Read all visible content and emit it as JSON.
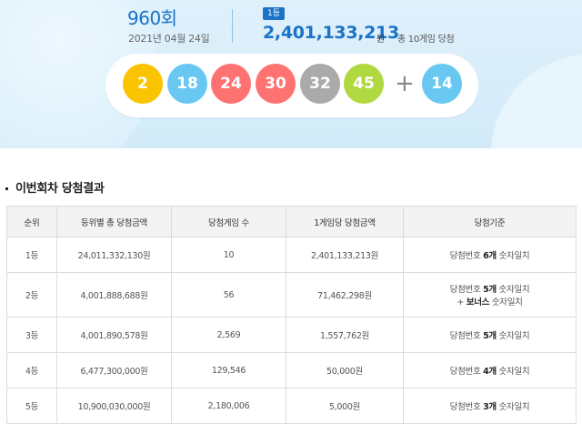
{
  "draw": {
    "round": "960회",
    "date": "2021년 04월 24일",
    "rank_badge": "1등",
    "prize": "2,401,133,213",
    "prize_unit": "원",
    "winners": "총 10게임 당첨",
    "numbers": [
      {
        "value": "2",
        "color": "#fbc400"
      },
      {
        "value": "18",
        "color": "#69c8f2"
      },
      {
        "value": "24",
        "color": "#ff7272"
      },
      {
        "value": "30",
        "color": "#ff7272"
      },
      {
        "value": "32",
        "color": "#aaaaaa"
      },
      {
        "value": "45",
        "color": "#b0d840"
      }
    ],
    "plus": "+",
    "bonus": {
      "value": "14",
      "color": "#69c8f2"
    }
  },
  "section_title": "이번회차 당첨결과",
  "table": {
    "headers": [
      "순위",
      "등위별 총 당첨금액",
      "당첨게임 수",
      "1게임당 당첨금액",
      "당첨기준"
    ],
    "rows": [
      {
        "rank": "1등",
        "total": "24,011,332,130원",
        "games": "10",
        "per_game": "2,401,133,213원",
        "crit_pre": "당첨번호 ",
        "crit_bold": "6개",
        "crit_post": " 숫자일치",
        "crit_line2_pre": "",
        "crit_line2_bold": "",
        "crit_line2_post": ""
      },
      {
        "rank": "2등",
        "total": "4,001,888,688원",
        "games": "56",
        "per_game": "71,462,298원",
        "crit_pre": "당첨번호 ",
        "crit_bold": "5개",
        "crit_post": " 숫자일치",
        "crit_line2_pre": "+ ",
        "crit_line2_bold": "보너스",
        "crit_line2_post": " 숫자일치"
      },
      {
        "rank": "3등",
        "total": "4,001,890,578원",
        "games": "2,569",
        "per_game": "1,557,762원",
        "crit_pre": "당첨번호 ",
        "crit_bold": "5개",
        "crit_post": " 숫자일치"
      },
      {
        "rank": "4등",
        "total": "6,477,300,000원",
        "games": "129,546",
        "per_game": "50,000원",
        "crit_pre": "당첨번호 ",
        "crit_bold": "4개",
        "crit_post": " 숫자일치"
      },
      {
        "rank": "5등",
        "total": "10,900,030,000원",
        "games": "2,180,006",
        "per_game": "5,000원",
        "crit_pre": "당첨번호 ",
        "crit_bold": "3개",
        "crit_post": " 숫자일치"
      }
    ]
  }
}
